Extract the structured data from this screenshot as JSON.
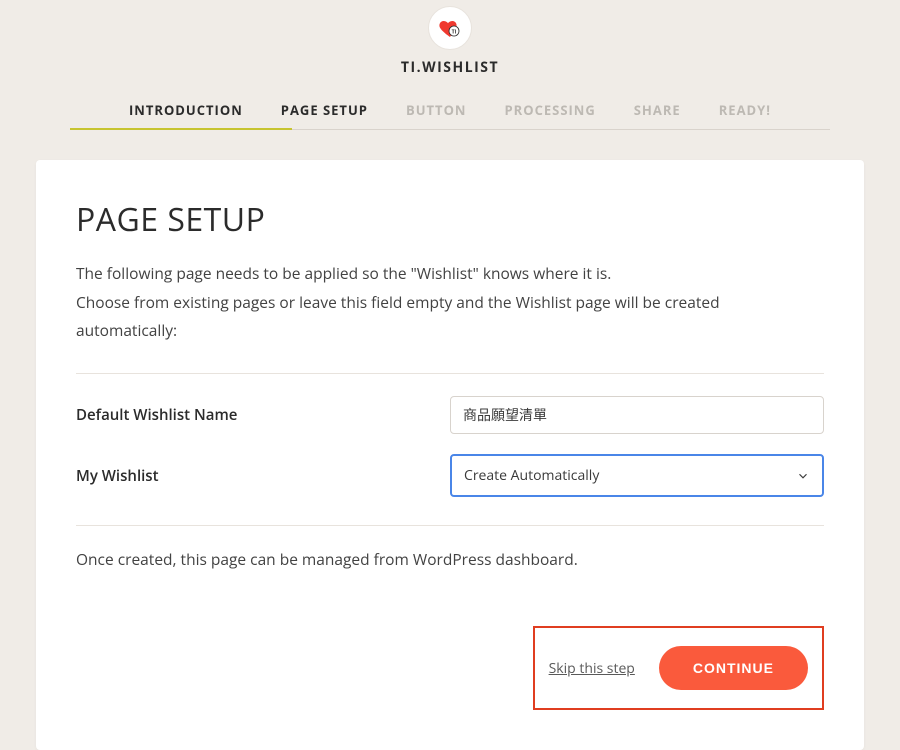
{
  "app": {
    "title": "TI.WISHLIST"
  },
  "tabs": [
    {
      "label": "INTRODUCTION",
      "state": "done"
    },
    {
      "label": "PAGE SETUP",
      "state": "active"
    },
    {
      "label": "BUTTON",
      "state": "future"
    },
    {
      "label": "PROCESSING",
      "state": "future"
    },
    {
      "label": "SHARE",
      "state": "future"
    },
    {
      "label": "READY!",
      "state": "future"
    }
  ],
  "page": {
    "title": "PAGE SETUP",
    "desc_line1": "The following page needs to be applied so the \"Wishlist\" knows where it is.",
    "desc_line2": "Choose from existing pages or leave this field empty and the Wishlist page will be created automatically:",
    "note": "Once created, this page can be managed from WordPress dashboard."
  },
  "form": {
    "default_name_label": "Default Wishlist Name",
    "default_name_value": "商品願望清單",
    "my_wishlist_label": "My Wishlist",
    "my_wishlist_selected": "Create Automatically"
  },
  "actions": {
    "skip": "Skip this step",
    "continue": "CONTINUE"
  },
  "colors": {
    "accent": "#fa5a3c",
    "highlight_border": "#e03d20",
    "tab_underline": "#c7c430",
    "select_focus": "#4a86e8"
  }
}
